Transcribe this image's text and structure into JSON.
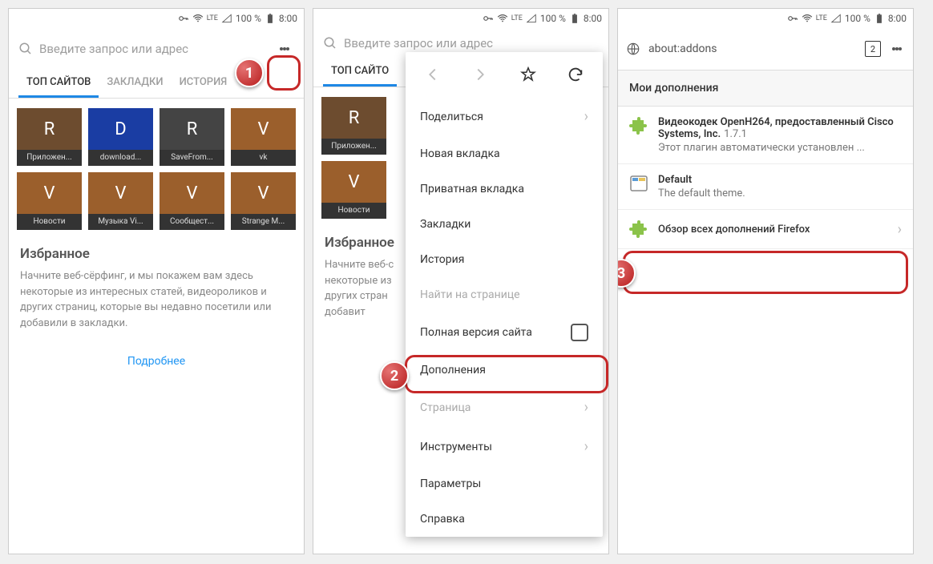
{
  "status": {
    "net": "LTE",
    "batt": "100 %",
    "time": "8:00"
  },
  "screen1": {
    "search_placeholder": "Введите запрос или адрес",
    "tabs": [
      "ТОП САЙТОВ",
      "ЗАКЛАДКИ",
      "ИСТОРИЯ"
    ],
    "tiles": [
      {
        "l": "R",
        "lab": "Приложен...",
        "c": "#6d4c2f"
      },
      {
        "l": "D",
        "lab": "download...",
        "c": "#1a3da3"
      },
      {
        "l": "R",
        "lab": "SaveFrom...",
        "c": "#444"
      },
      {
        "l": "V",
        "lab": "vk",
        "c": "#9b5f2c"
      },
      {
        "l": "V",
        "lab": "Новости",
        "c": "#9b5f2c"
      },
      {
        "l": "V",
        "lab": "Музыка Vi...",
        "c": "#9b5f2c"
      },
      {
        "l": "V",
        "lab": "Сообщест...",
        "c": "#9b5f2c"
      },
      {
        "l": "V",
        "lab": "Strange M...",
        "c": "#9b5f2c"
      }
    ],
    "fav_title": "Избранное",
    "fav_text": "Начните веб-сёрфинг, и мы покажем вам здесь некоторые из интересных статей, видеороликов и других страниц, которые вы недавно посетили или добавили в закладки.",
    "more": "Подробнее"
  },
  "screen2": {
    "tiles": [
      {
        "l": "R",
        "lab": "Приложен...",
        "c": "#6d4c2f"
      },
      {
        "l": "V",
        "lab": "Новости",
        "c": "#9b5f2c"
      }
    ],
    "menu": {
      "share": "Поделиться",
      "newtab": "Новая вкладка",
      "private": "Приватная вкладка",
      "bookmarks": "Закладки",
      "history": "История",
      "find": "Найти на странице",
      "desktop": "Полная версия сайта",
      "addons": "Дополнения",
      "page": "Страница",
      "tools": "Инструменты",
      "settings": "Параметры",
      "help": "Справка"
    }
  },
  "screen3": {
    "url": "about:addons",
    "tab_count": "2",
    "header": "Мои дополнения",
    "addon1": {
      "title": "Видеокодек OpenH264, предоставленный Cisco Systems, Inc.",
      "ver": "1.7.1",
      "desc": "Этот плагин автоматически установлен ..."
    },
    "addon2": {
      "title": "Default",
      "desc": "The default theme."
    },
    "browse": "Обзор всех дополнений Firefox"
  },
  "badges": {
    "b1": "1",
    "b2": "2",
    "b3": "3"
  }
}
